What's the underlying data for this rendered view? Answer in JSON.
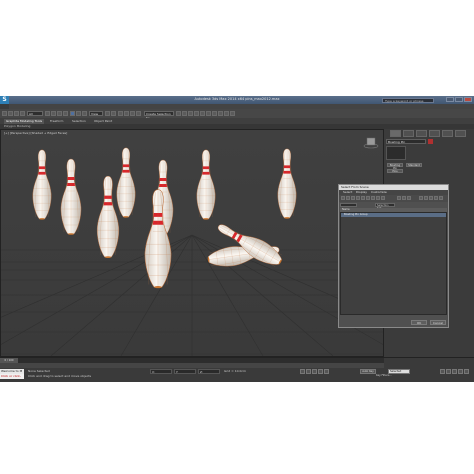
{
  "app": {
    "logo": "S",
    "title": "Autodesk 3ds Max 2014 x64    pins_max2012.max",
    "search_placeholder": "Type a keyword or phrase",
    "ribbon_tabs": [
      "Graphite Modeling Tools",
      "Freeform",
      "Selection",
      "Object Paint"
    ],
    "sub_ribbon": "Polygon Modeling",
    "viewport_label": "[+] [Perspective] [Shaded + Edged Faces]",
    "toolbar": {
      "undo_combo": "All",
      "view_combo": "View",
      "selection_set": "Create Selection Se"
    }
  },
  "command_panel": {
    "object_name": "Bowling Pin",
    "color_swatch": "#b03030",
    "buttons": [
      "Bowling Pin",
      "Standard",
      "Pins"
    ]
  },
  "viewport": {
    "background": "#3c3c3c",
    "pin_body_color": "#f2ece6",
    "pin_stripe_color": "#d8262b",
    "wire_color": "#c06a30"
  },
  "dialog": {
    "title": "Select From Scene",
    "menu": [
      "Select",
      "Display",
      "Customize"
    ],
    "selection_set_label": "Selection Set:",
    "column_header": "Name",
    "rows": [
      "Bowling Pin Group"
    ],
    "ok": "OK",
    "cancel": "Cancel"
  },
  "status": {
    "timeline": "0 / 100",
    "listener_top": "Welcome to M",
    "listener_bottom": "Click or click-",
    "selection": "None Selected",
    "prompt": "Click and drag to select and move objects",
    "x_label": "X:",
    "y_label": "Y:",
    "z_label": "Z:",
    "grid": "Grid = 10.0cm",
    "auto_key": "Auto Key",
    "set_key": "Set Key",
    "key_filters": "Key Filters...",
    "selected_combo": "Selected"
  }
}
